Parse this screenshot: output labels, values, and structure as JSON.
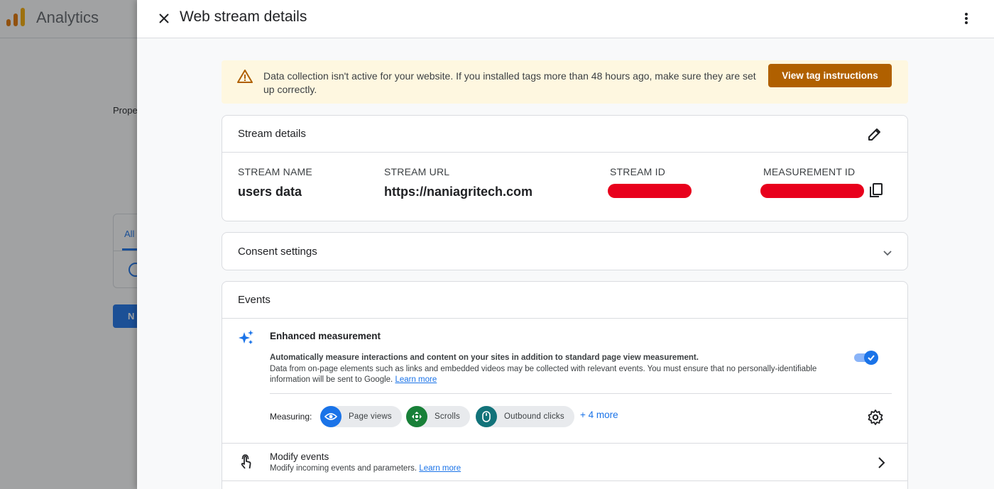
{
  "background": {
    "app_title": "Analytics",
    "property_label": "Prope",
    "card_tab_label": "All",
    "button_label": "N"
  },
  "drawer": {
    "title": "Web stream details"
  },
  "banner": {
    "message": "Data collection isn't active for your website. If you installed tags more than 48 hours ago, make sure they are set up correctly.",
    "button_label": "View tag instructions",
    "icon": "warning-icon",
    "color": "#b06000"
  },
  "stream_details": {
    "title": "Stream details",
    "stream_name_label": "STREAM NAME",
    "stream_name": "users data",
    "stream_url_label": "STREAM URL",
    "stream_url": "https://naniagritech.com",
    "stream_id_label": "STREAM ID",
    "measurement_id_label": "MEASUREMENT ID"
  },
  "consent": {
    "title": "Consent settings"
  },
  "events": {
    "title": "Events",
    "enhanced_measurement": {
      "title": "Enhanced measurement",
      "description_bold": "Automatically measure interactions and content on your sites in addition to standard page view measurement.",
      "description": "Data from on-page elements such as links and embedded videos may be collected with relevant events. You must ensure that no personally-identifiable information will be sent to Google.",
      "learn_more": "Learn more",
      "enabled": true
    },
    "measuring_label": "Measuring:",
    "chips": [
      {
        "label": "Page views",
        "color": "#1a73e8",
        "icon": "eye-icon"
      },
      {
        "label": "Scrolls",
        "color": "#188038",
        "icon": "scroll-icon"
      },
      {
        "label": "Outbound clicks",
        "color": "#12737a",
        "icon": "mouse-icon"
      }
    ],
    "more_label": "+ 4 more",
    "modify_events": {
      "title": "Modify events",
      "subtitle": "Modify incoming events and parameters.",
      "learn_more": "Learn more"
    }
  }
}
